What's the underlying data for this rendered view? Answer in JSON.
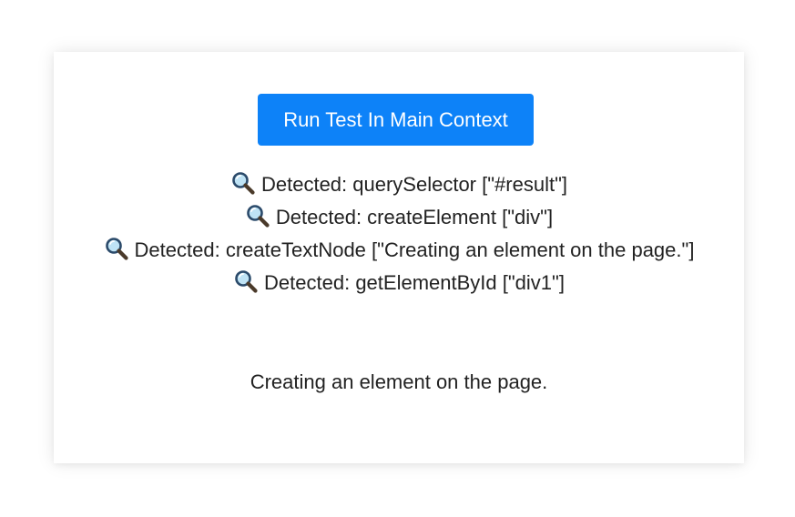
{
  "run_button": {
    "label": "Run Test In Main Context"
  },
  "log": {
    "icon": "magnifying-glass-icon",
    "lines": [
      {
        "text": "Detected: querySelector [\"#result\"]"
      },
      {
        "text": "Detected: createElement [\"div\"]"
      },
      {
        "text": "Detected: createTextNode [\"Creating an element on the page.\"]"
      },
      {
        "text": "Detected: getElementById [\"div1\"]"
      }
    ]
  },
  "result": {
    "text": "Creating an element on the page."
  },
  "colors": {
    "button_bg": "#0d82f8",
    "button_text": "#ffffff",
    "text": "#222222"
  }
}
